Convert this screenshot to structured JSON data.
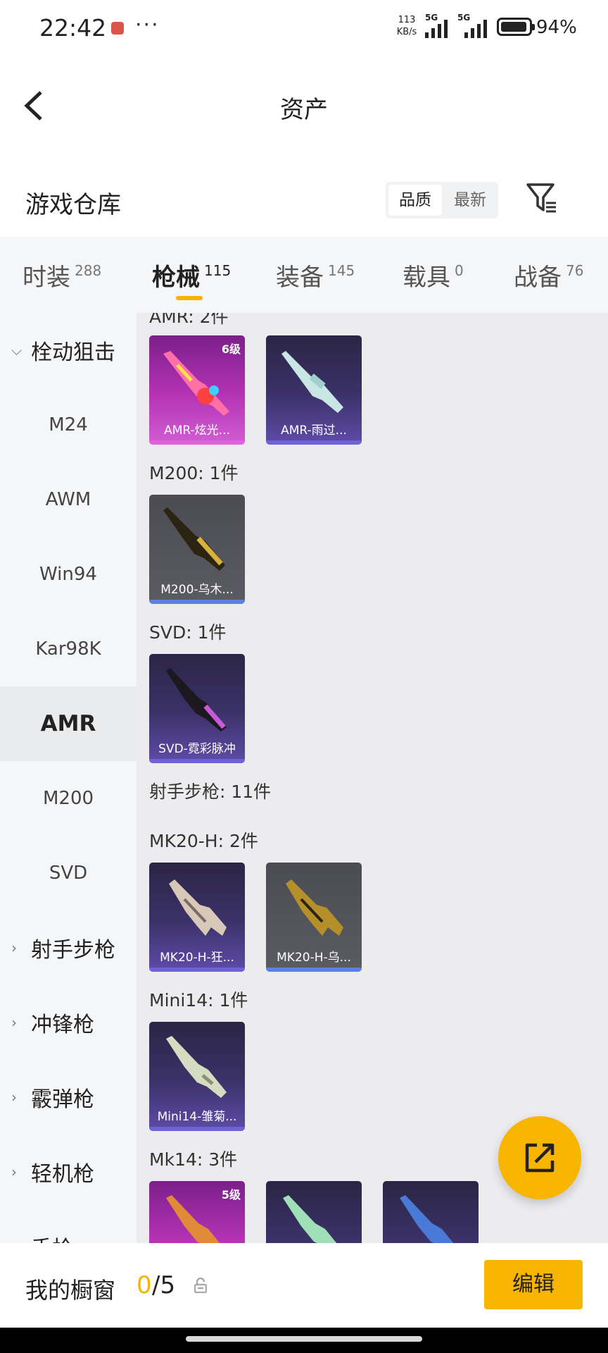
{
  "status_bar": {
    "time": "22:42",
    "more": "···",
    "net_speed_value": "113",
    "net_speed_unit": "KB/s",
    "signal1": "5G",
    "signal2": "5G",
    "battery_level": 0.94,
    "battery": "94%"
  },
  "header": {
    "title": "资产",
    "warehouse_title": "游戏仓库",
    "sort_options": [
      "品质",
      "最新"
    ],
    "sort_selected": "品质"
  },
  "tabs": [
    {
      "label": "时装",
      "count": "288"
    },
    {
      "label": "枪械",
      "count": "115",
      "active": true
    },
    {
      "label": "装备",
      "count": "145"
    },
    {
      "label": "载具",
      "count": "0"
    },
    {
      "label": "战备",
      "count": "76"
    }
  ],
  "sidebar": {
    "group_open": "栓动狙击",
    "items": [
      "M24",
      "AWM",
      "Win94",
      "Kar98K",
      "AMR",
      "M200",
      "SVD"
    ],
    "active_item": "AMR",
    "groups_collapsed": [
      "射手步枪",
      "冲锋枪",
      "霰弹枪",
      "轻机枪",
      "手枪"
    ]
  },
  "content": {
    "sections": [
      {
        "label": "AMR: 2件",
        "cards": [
          {
            "name": "AMR-炫光...",
            "level": "6级",
            "rarity": "pink"
          },
          {
            "name": "AMR-雨过...",
            "level": "",
            "rarity": "purple"
          }
        ]
      },
      {
        "label": "M200: 1件",
        "cards": [
          {
            "name": "M200-乌木...",
            "level": "",
            "rarity": "gray"
          }
        ]
      },
      {
        "label": "SVD: 1件",
        "cards": [
          {
            "name": "SVD-霓彩脉冲",
            "level": "",
            "rarity": "purple"
          }
        ]
      },
      {
        "label": "射手步枪: 11件",
        "cards": []
      },
      {
        "label": "MK20-H: 2件",
        "cards": [
          {
            "name": "MK20-H-狂...",
            "level": "",
            "rarity": "purple"
          },
          {
            "name": "MK20-H-乌...",
            "level": "",
            "rarity": "gray"
          }
        ]
      },
      {
        "label": "Mini14: 1件",
        "cards": [
          {
            "name": "Mini14-雏菊...",
            "level": "",
            "rarity": "purple"
          }
        ]
      },
      {
        "label": "Mk14: 3件",
        "cards": [
          {
            "name": "",
            "level": "5级",
            "rarity": "pink"
          },
          {
            "name": "",
            "level": "",
            "rarity": "purple"
          },
          {
            "name": "",
            "level": "",
            "rarity": "purple"
          }
        ]
      }
    ]
  },
  "bottom": {
    "showcase_label": "我的橱窗",
    "showcase_current": "0",
    "showcase_max": "/5",
    "edit_label": "编辑"
  },
  "colors": {
    "accent": "#f7b500",
    "page_bg": "#ececef",
    "sidebar_bg": "#f5f6f8"
  },
  "icons": [
    "back-icon",
    "filter-icon",
    "share-icon",
    "lock-icon",
    "chevron-down-icon",
    "chevron-right-icon"
  ]
}
